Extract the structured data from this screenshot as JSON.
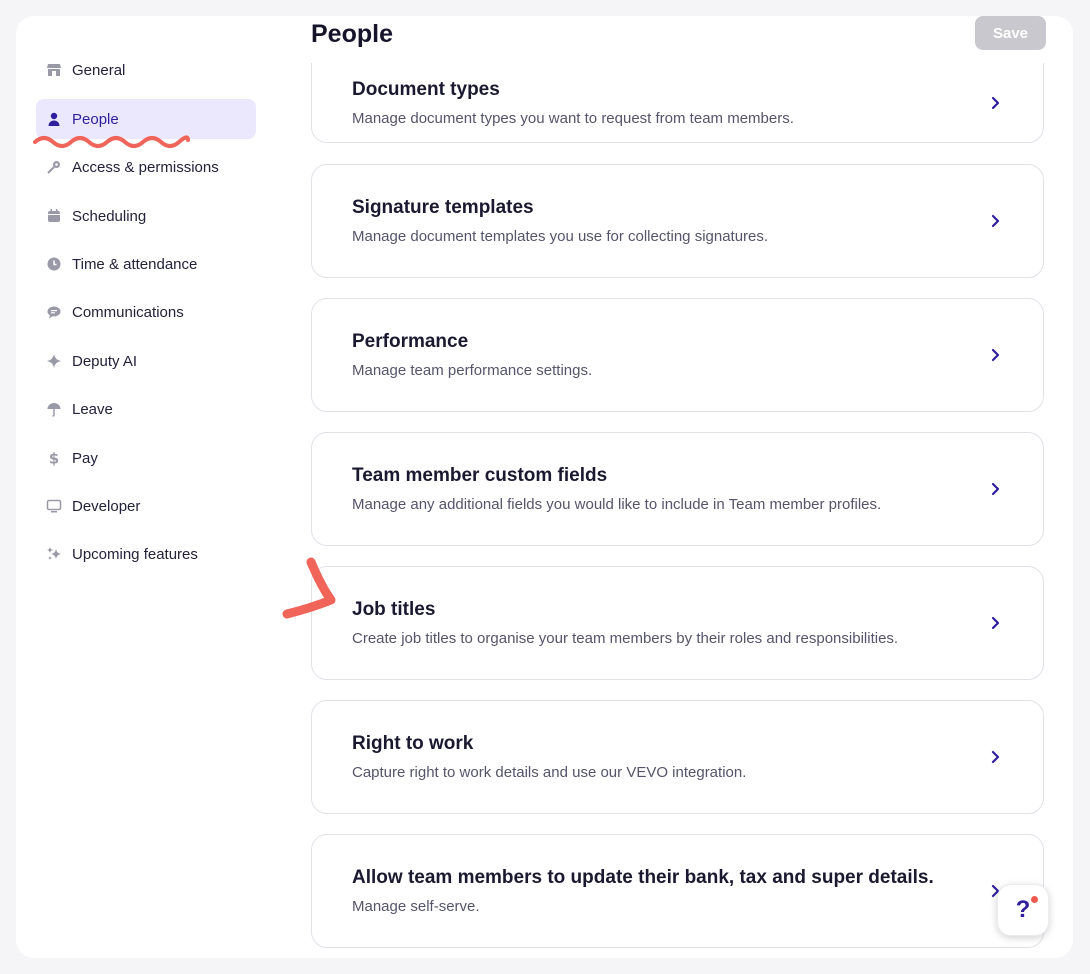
{
  "header": {
    "title": "People",
    "save_label": "Save"
  },
  "sidebar": {
    "items": [
      {
        "label": "General",
        "icon": "store-icon"
      },
      {
        "label": "People",
        "icon": "person-icon",
        "active": true
      },
      {
        "label": "Access & permissions",
        "icon": "key-icon"
      },
      {
        "label": "Scheduling",
        "icon": "calendar-icon"
      },
      {
        "label": "Time & attendance",
        "icon": "clock-icon"
      },
      {
        "label": "Communications",
        "icon": "chat-icon"
      },
      {
        "label": "Deputy AI",
        "icon": "sparkle-icon"
      },
      {
        "label": "Leave",
        "icon": "umbrella-icon"
      },
      {
        "label": "Pay",
        "icon": "dollar-icon"
      },
      {
        "label": "Developer",
        "icon": "monitor-icon"
      },
      {
        "label": "Upcoming features",
        "icon": "sparkles-icon"
      }
    ]
  },
  "cards": [
    {
      "title": "Document types",
      "desc": "Manage document types you want to request from team members."
    },
    {
      "title": "Signature templates",
      "desc": "Manage document templates you use for collecting signatures."
    },
    {
      "title": "Performance",
      "desc": "Manage team performance settings."
    },
    {
      "title": "Team member custom fields",
      "desc": "Manage any additional fields you would like to include in Team member profiles."
    },
    {
      "title": "Job titles",
      "desc": "Create job titles to organise your team members by their roles and responsibilities."
    },
    {
      "title": "Right to work",
      "desc": "Capture right to work details and use our VEVO integration."
    },
    {
      "title": "Allow team members to update their bank, tax and super details.",
      "desc": "Manage self-serve."
    }
  ],
  "help": {
    "label": "?"
  },
  "colors": {
    "accent": "#2f1f9c",
    "active_bg": "#ebe8fd",
    "annotation": "#f0645a",
    "save_disabled": "#c9c8cf"
  }
}
